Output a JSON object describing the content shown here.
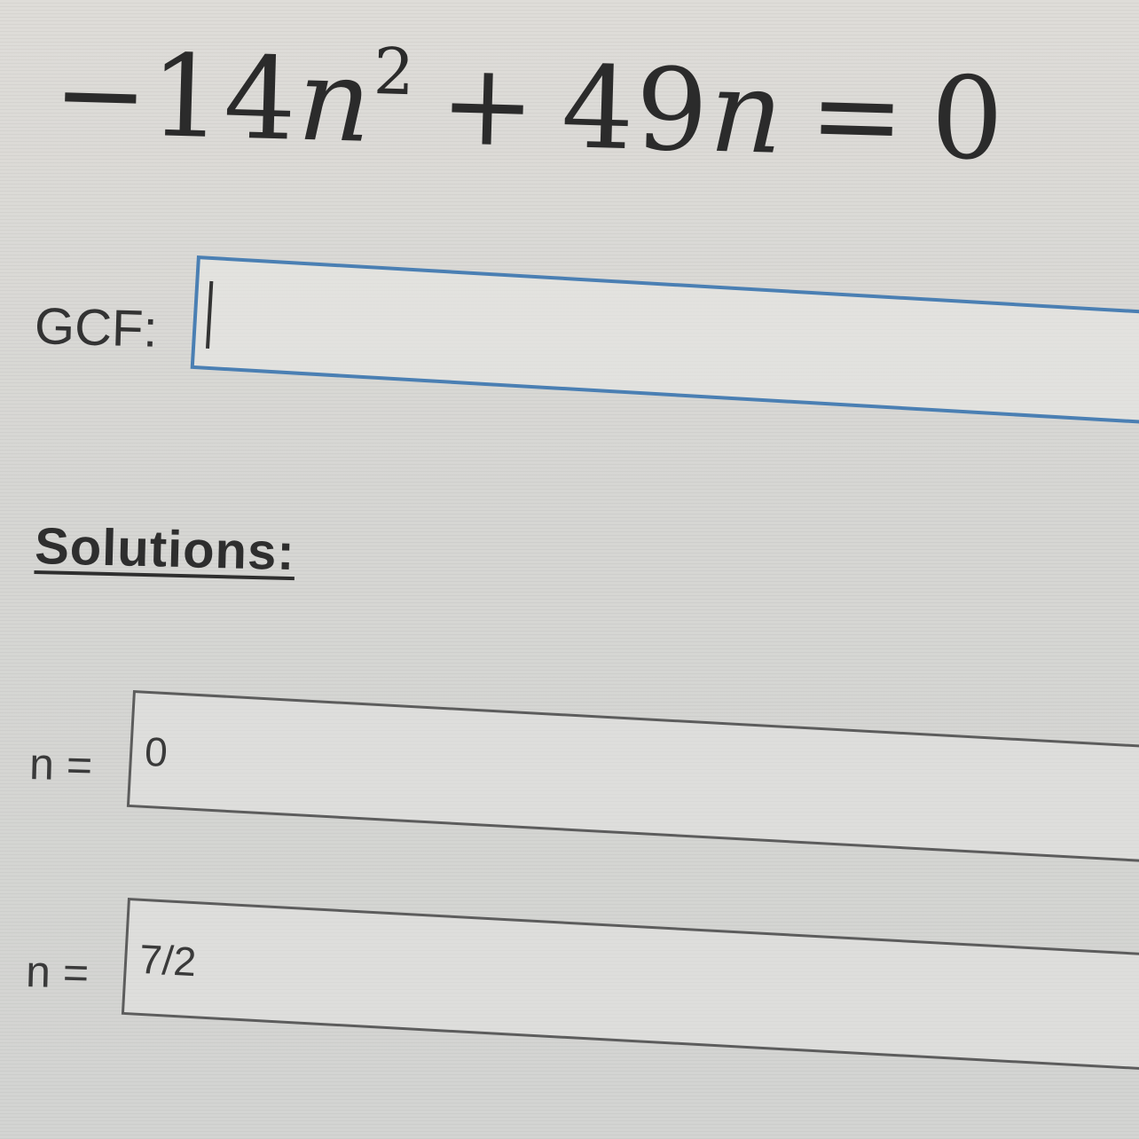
{
  "equation": {
    "sign": "−",
    "coef1": "14",
    "var1": "n",
    "exp1": "2",
    "op": "+",
    "coef2": "49",
    "var2": "n",
    "eq": "=",
    "rhs": "0"
  },
  "gcf": {
    "label": "GCF:",
    "value": ""
  },
  "solutions": {
    "heading": "Solutions:",
    "items": [
      {
        "label": "n =",
        "value": "0"
      },
      {
        "label": "n =",
        "value": "7/2"
      }
    ]
  }
}
